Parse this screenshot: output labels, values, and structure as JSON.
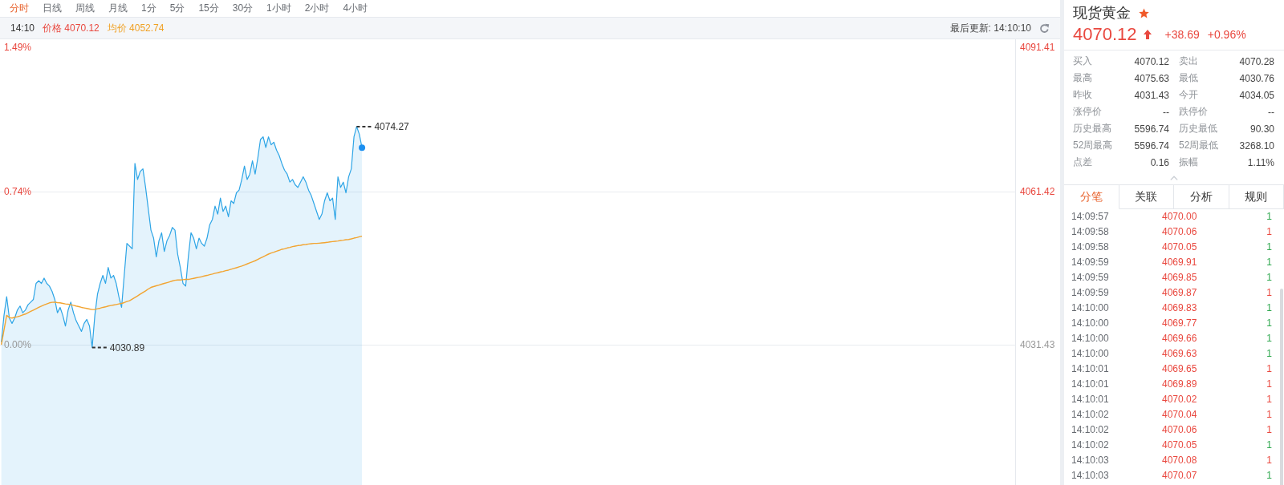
{
  "toolbar": {
    "tabs": [
      {
        "label": "分时",
        "selected": true
      },
      {
        "label": "日线",
        "selected": false
      },
      {
        "label": "周线",
        "selected": false
      },
      {
        "label": "月线",
        "selected": false
      },
      {
        "label": "1分",
        "selected": false
      },
      {
        "label": "5分",
        "selected": false
      },
      {
        "label": "15分",
        "selected": false
      },
      {
        "label": "30分",
        "selected": false
      },
      {
        "label": "1小时",
        "selected": false
      },
      {
        "label": "2小时",
        "selected": false
      },
      {
        "label": "4小时",
        "selected": false
      }
    ]
  },
  "info_bar": {
    "time": "14:10",
    "legend": [
      {
        "label": "价格",
        "value": "4070.12",
        "color": "#e9483f"
      },
      {
        "label": "均价",
        "value": "4052.74",
        "color": "#f0a023"
      }
    ],
    "last_updated": "最后更新: 14:10:10"
  },
  "chart": {
    "percent_labels": [
      {
        "text": "1.49%",
        "color": "#e9483f"
      },
      {
        "text": "0.74%",
        "color": "#e9483f"
      },
      {
        "text": "0.00%",
        "color": "#999999"
      }
    ],
    "chart_data": {
      "type": "area",
      "categories": [
        null,
        null,
        null,
        null,
        null,
        null,
        null,
        null,
        null,
        null,
        null,
        null,
        null,
        null,
        null,
        null,
        null,
        null,
        null,
        null,
        null,
        null,
        null,
        null,
        null,
        null,
        null,
        null,
        null,
        null,
        null,
        null,
        null,
        null,
        null,
        null,
        null,
        null,
        null,
        null,
        null,
        null,
        null,
        null,
        null,
        null,
        null,
        null,
        null,
        null,
        null,
        null,
        null,
        null,
        null,
        null,
        null,
        null,
        null,
        null,
        null,
        null,
        null,
        null,
        null,
        null,
        null,
        null,
        null,
        null,
        null,
        null,
        null,
        null,
        null,
        null,
        null,
        null,
        null,
        null,
        null,
        null,
        null,
        null,
        null,
        null,
        null,
        null,
        null,
        null,
        null,
        null,
        null,
        null,
        null,
        null,
        null,
        null,
        null,
        null,
        null,
        null,
        null,
        null,
        null,
        null,
        null,
        null,
        null,
        null,
        null,
        null,
        null,
        null,
        null,
        null,
        null,
        null,
        null,
        null,
        null,
        null,
        null,
        null,
        null,
        null,
        null,
        null,
        null,
        null,
        null,
        null,
        null,
        null,
        null,
        null,
        null,
        null,
        null,
        null,
        null,
        null,
        null,
        null,
        null,
        null,
        null,
        null,
        null,
        null,
        null,
        null,
        null,
        null,
        null,
        null,
        null,
        null,
        null,
        null,
        null,
        null,
        null,
        null,
        null,
        null,
        null,
        null,
        null,
        null,
        null,
        null,
        null,
        null,
        null,
        null,
        null,
        null,
        null,
        null,
        null,
        null,
        null,
        null,
        null,
        null,
        null,
        null,
        null,
        null,
        null,
        null,
        null,
        null,
        null,
        null,
        null,
        null,
        null,
        null,
        null,
        null,
        null,
        null,
        null,
        null,
        null,
        null,
        null,
        null,
        null,
        null,
        null,
        null,
        null,
        null,
        null,
        null,
        null,
        null,
        null,
        null,
        null,
        null,
        null,
        null,
        null,
        null,
        null,
        null,
        null,
        null,
        null,
        null,
        null,
        null,
        null,
        null,
        null,
        null,
        null,
        null,
        null,
        null,
        null,
        null,
        null,
        null,
        null,
        null,
        null,
        null,
        null,
        null,
        null,
        null,
        null,
        null,
        null,
        null,
        null,
        null,
        null,
        null,
        null,
        null,
        null,
        null,
        null,
        null,
        null,
        null,
        null,
        null,
        null,
        null,
        null,
        null,
        null,
        null,
        null,
        null,
        null,
        null,
        null,
        null,
        null,
        null,
        null,
        null,
        null,
        null,
        null,
        null,
        null,
        null,
        null,
        null,
        null,
        null,
        null,
        null,
        null,
        null,
        null,
        null,
        null,
        null,
        null,
        null,
        null,
        null,
        null,
        null,
        null,
        null,
        null,
        null,
        null,
        null,
        null,
        null,
        null,
        null,
        null,
        null,
        null,
        null,
        null,
        null,
        null,
        null,
        null,
        null,
        null,
        null,
        null,
        null,
        null,
        null,
        null,
        null,
        null,
        null,
        null,
        null,
        null,
        null,
        null,
        null,
        null,
        null,
        null,
        null,
        null,
        null,
        null,
        null,
        null,
        null,
        null,
        null,
        null,
        null,
        null,
        null,
        null,
        null,
        null,
        null,
        null,
        null,
        null,
        null,
        null,
        null,
        null,
        null,
        null,
        null
      ],
      "ylim": [
        4003.88,
        4091.41
      ],
      "yticks": [
        {
          "value": 4091.41,
          "label": "4091.41"
        },
        {
          "value": 4061.42,
          "label": "4061.42"
        },
        {
          "value": 4031.43,
          "label": "4031.43"
        }
      ],
      "series": [
        {
          "color": "#2ea5e6",
          "values": [
            4031.95,
            4037.19,
            4040.85,
            4036.66,
            4035.62,
            4036.66,
            4038.23,
            4039.02,
            4037.71,
            4038.23,
            4039.28,
            4039.8,
            4040.33,
            4043.47,
            4043.99,
            4043.47,
            4044.51,
            4043.47,
            4042.94,
            4041.9,
            4040.33,
            4037.71,
            4038.76,
            4037.19,
            4035.09,
            4038.23,
            4039.8,
            4037.71,
            4036.14,
            4035.09,
            4034.05,
            4035.62,
            4036.4,
            4035.09,
            4030.89,
            4037.19,
            4041.37,
            4043.47,
            4045.04,
            4043.47,
            4046.61,
            4044.51,
            4045.04,
            4043.47,
            4040.85,
            4038.76,
            4045.04,
            4051.32,
            4050.79,
            4050.27,
            4067.02,
            4063.88,
            4065.45,
            4065.97,
            4062.31,
            4058.12,
            4053.93,
            4052.36,
            4048.7,
            4051.84,
            4053.41,
            4049.75,
            4051.84,
            4052.89,
            4054.46,
            4053.93,
            4049.22,
            4046.61,
            4043.47,
            4042.94,
            4048.7,
            4053.41,
            4052.36,
            4050.27,
            4052.36,
            4051.32,
            4050.79,
            4052.36,
            4054.98,
            4056.03,
            4058.65,
            4057.08,
            4060.22,
            4057.6,
            4058.65,
            4056.55,
            4059.69,
            4059.17,
            4061.26,
            4061.79,
            4063.88,
            4066.5,
            4063.88,
            4064.93,
            4067.54,
            4064.93,
            4068.07,
            4071.73,
            4072.25,
            4070.16,
            4072.25,
            4070.68,
            4071.21,
            4069.64,
            4068.59,
            4067.02,
            4065.71,
            4064.93,
            4063.36,
            4063.88,
            4062.83,
            4062.31,
            4063.36,
            4064.4,
            4063.36,
            4061.79,
            4060.74,
            4059.17,
            4057.6,
            4056.03,
            4057.08,
            4059.69,
            4061.26,
            4059.69,
            4060.22,
            4056.03,
            4064.4,
            4062.31,
            4063.36,
            4061.26,
            4064.4,
            4065.97,
            4072.25,
            4074.27,
            4072.78,
            4070.12,
            null,
            null,
            null,
            null,
            null,
            null,
            null,
            null,
            null,
            null,
            null,
            null,
            null,
            null,
            null,
            null,
            null,
            null,
            null,
            null,
            null,
            null,
            null,
            null,
            null,
            null,
            null,
            null,
            null,
            null,
            null,
            null,
            null,
            null,
            null,
            null,
            null,
            null,
            null,
            null,
            null,
            null,
            null,
            null,
            null,
            null,
            null,
            null,
            null,
            null,
            null,
            null,
            null,
            null,
            null,
            null,
            null,
            null,
            null,
            null,
            null,
            null,
            null,
            null,
            null,
            null,
            null,
            null,
            null,
            null,
            null,
            null,
            null,
            null,
            null,
            null,
            null,
            null,
            null,
            null,
            null,
            null,
            null,
            null,
            null,
            null,
            null,
            null,
            null,
            null,
            null,
            null,
            null,
            null,
            null,
            null,
            null,
            null,
            null,
            null,
            null,
            null,
            null,
            null,
            null,
            null,
            null,
            null,
            null,
            null,
            null,
            null,
            null,
            null,
            null,
            null,
            null,
            null,
            null,
            null,
            null,
            null,
            null,
            null,
            null,
            null,
            null,
            null,
            null,
            null,
            null,
            null,
            null,
            null,
            null,
            null,
            null,
            null,
            null,
            null,
            null,
            null,
            null,
            null,
            null,
            null,
            null,
            null,
            null,
            null,
            null,
            null,
            null,
            null,
            null,
            null,
            null,
            null,
            null,
            null,
            null,
            null,
            null,
            null,
            null,
            null,
            null,
            null,
            null,
            null,
            null,
            null,
            null,
            null,
            null,
            null,
            null,
            null,
            null,
            null,
            null,
            null,
            null,
            null,
            null,
            null,
            null,
            null,
            null,
            null,
            null,
            null,
            null,
            null,
            null,
            null,
            null,
            null,
            null,
            null,
            null,
            null,
            null,
            null,
            null,
            null,
            null,
            null,
            null,
            null,
            null,
            null,
            null,
            null,
            null,
            null,
            null,
            null,
            null,
            null,
            null,
            null,
            null,
            null,
            null,
            null,
            null,
            null,
            null,
            null,
            null,
            null,
            null,
            null,
            null,
            null,
            null,
            null,
            null,
            null,
            null,
            null,
            null,
            null
          ]
        },
        {
          "type": "line",
          "color": "#f2a431",
          "values": [
            4031.43,
            4034.31,
            4037.19,
            4036.77,
            4036.66,
            4036.82,
            4036.92,
            4037.08,
            4037.29,
            4037.45,
            4037.71,
            4037.97,
            4038.23,
            4038.49,
            4038.76,
            4039.02,
            4039.23,
            4039.44,
            4039.65,
            4039.75,
            4039.8,
            4039.7,
            4039.65,
            4039.54,
            4039.44,
            4039.38,
            4039.28,
            4039.17,
            4039.02,
            4038.91,
            4038.76,
            4038.65,
            4038.55,
            4038.44,
            4038.34,
            4038.34,
            4038.49,
            4038.6,
            4038.76,
            4038.86,
            4039.02,
            4039.12,
            4039.23,
            4039.33,
            4039.44,
            4039.54,
            4039.7,
            4039.91,
            4040.06,
            4040.38,
            4040.69,
            4041.01,
            4041.37,
            4041.69,
            4042.0,
            4042.37,
            4042.68,
            4042.84,
            4043.0,
            4043.15,
            4043.31,
            4043.47,
            4043.62,
            4043.78,
            4043.94,
            4044.09,
            4044.15,
            4044.15,
            4044.2,
            4044.25,
            4044.25,
            4044.36,
            4044.46,
            4044.57,
            4044.67,
            4044.78,
            4044.93,
            4045.04,
            4045.19,
            4045.3,
            4045.46,
            4045.56,
            4045.72,
            4045.82,
            4045.98,
            4046.08,
            4046.24,
            4046.4,
            4046.55,
            4046.71,
            4046.87,
            4047.08,
            4047.29,
            4047.5,
            4047.71,
            4047.92,
            4048.18,
            4048.44,
            4048.7,
            4048.96,
            4049.22,
            4049.43,
            4049.59,
            4049.8,
            4049.96,
            4050.17,
            4050.27,
            4050.43,
            4050.53,
            4050.69,
            4050.79,
            4050.9,
            4050.95,
            4051.06,
            4051.11,
            4051.21,
            4051.27,
            4051.32,
            4051.32,
            4051.37,
            4051.42,
            4051.47,
            4051.53,
            4051.63,
            4051.68,
            4051.74,
            4051.79,
            4051.89,
            4051.95,
            4052.05,
            4052.1,
            4052.21,
            4052.36,
            4052.47,
            4052.63,
            4052.74,
            null,
            null,
            null,
            null,
            null,
            null,
            null,
            null,
            null,
            null,
            null,
            null,
            null,
            null,
            null,
            null,
            null,
            null,
            null,
            null,
            null,
            null,
            null,
            null,
            null,
            null,
            null,
            null,
            null,
            null,
            null,
            null,
            null,
            null,
            null,
            null,
            null,
            null,
            null,
            null,
            null,
            null,
            null,
            null,
            null,
            null,
            null,
            null,
            null,
            null,
            null,
            null,
            null,
            null,
            null,
            null,
            null,
            null,
            null,
            null,
            null,
            null,
            null,
            null,
            null,
            null,
            null,
            null,
            null,
            null,
            null,
            null,
            null,
            null,
            null,
            null,
            null,
            null,
            null,
            null,
            null,
            null,
            null,
            null,
            null,
            null,
            null,
            null,
            null,
            null,
            null,
            null,
            null,
            null,
            null,
            null,
            null,
            null,
            null,
            null,
            null,
            null,
            null,
            null,
            null,
            null,
            null,
            null,
            null,
            null,
            null,
            null,
            null,
            null,
            null,
            null,
            null,
            null,
            null,
            null,
            null,
            null,
            null,
            null,
            null,
            null,
            null,
            null,
            null,
            null,
            null,
            null,
            null,
            null,
            null,
            null,
            null,
            null,
            null,
            null,
            null,
            null,
            null,
            null,
            null,
            null,
            null,
            null,
            null,
            null,
            null,
            null,
            null,
            null,
            null,
            null,
            null,
            null,
            null,
            null,
            null,
            null,
            null,
            null,
            null,
            null,
            null,
            null,
            null,
            null,
            null,
            null,
            null,
            null,
            null,
            null,
            null,
            null,
            null,
            null,
            null,
            null,
            null,
            null,
            null,
            null,
            null,
            null,
            null,
            null,
            null,
            null,
            null,
            null,
            null,
            null,
            null,
            null,
            null,
            null,
            null,
            null,
            null,
            null,
            null,
            null,
            null,
            null,
            null,
            null,
            null,
            null,
            null,
            null,
            null,
            null,
            null,
            null,
            null,
            null,
            null,
            null,
            null,
            null,
            null,
            null,
            null,
            null,
            null,
            null,
            null,
            null,
            null,
            null,
            null,
            null,
            null,
            null,
            null,
            null,
            null,
            null,
            null,
            null
          ]
        }
      ],
      "annotations": [
        "4074.27",
        "4030.89"
      ]
    }
  },
  "quote": {
    "title": "现货黄金",
    "starred": true,
    "price": "4070.12",
    "rising": true,
    "change": "+38.69",
    "change_percent": "+0.96%",
    "stats": [
      {
        "label": "买入",
        "value": "4070.12"
      },
      {
        "label": "卖出",
        "value": "4070.28"
      },
      {
        "label": "最高",
        "value": "4075.63"
      },
      {
        "label": "最低",
        "value": "4030.76"
      },
      {
        "label": "昨收",
        "value": "4031.43"
      },
      {
        "label": "今开",
        "value": "4034.05"
      },
      {
        "label": "涨停价",
        "value": "--"
      },
      {
        "label": "跌停价",
        "value": "--"
      },
      {
        "label": "历史最高",
        "value": "5596.74"
      },
      {
        "label": "历史最低",
        "value": "90.30"
      },
      {
        "label": "52周最高",
        "value": "5596.74"
      },
      {
        "label": "52周最低",
        "value": "3268.10"
      },
      {
        "label": "点差",
        "value": "0.16"
      },
      {
        "label": "振幅",
        "value": "1.11%"
      }
    ]
  },
  "detail_tabs": [
    {
      "label": "分笔",
      "selected": true
    },
    {
      "label": "关联",
      "selected": false
    },
    {
      "label": "分析",
      "selected": false
    },
    {
      "label": "规则",
      "selected": false
    }
  ],
  "ticks": [
    {
      "time": "14:09:57",
      "price": "4070.00",
      "volume": "1",
      "color": "#2fa84f"
    },
    {
      "time": "14:09:58",
      "price": "4070.06",
      "volume": "1",
      "color": "#e9483f"
    },
    {
      "time": "14:09:58",
      "price": "4070.05",
      "volume": "1",
      "color": "#2fa84f"
    },
    {
      "time": "14:09:59",
      "price": "4069.91",
      "volume": "1",
      "color": "#2fa84f"
    },
    {
      "time": "14:09:59",
      "price": "4069.85",
      "volume": "1",
      "color": "#2fa84f"
    },
    {
      "time": "14:09:59",
      "price": "4069.87",
      "volume": "1",
      "color": "#e9483f"
    },
    {
      "time": "14:10:00",
      "price": "4069.83",
      "volume": "1",
      "color": "#2fa84f"
    },
    {
      "time": "14:10:00",
      "price": "4069.77",
      "volume": "1",
      "color": "#2fa84f"
    },
    {
      "time": "14:10:00",
      "price": "4069.66",
      "volume": "1",
      "color": "#2fa84f"
    },
    {
      "time": "14:10:00",
      "price": "4069.63",
      "volume": "1",
      "color": "#2fa84f"
    },
    {
      "time": "14:10:01",
      "price": "4069.65",
      "volume": "1",
      "color": "#e9483f"
    },
    {
      "time": "14:10:01",
      "price": "4069.89",
      "volume": "1",
      "color": "#e9483f"
    },
    {
      "time": "14:10:01",
      "price": "4070.02",
      "volume": "1",
      "color": "#e9483f"
    },
    {
      "time": "14:10:02",
      "price": "4070.04",
      "volume": "1",
      "color": "#e9483f"
    },
    {
      "time": "14:10:02",
      "price": "4070.06",
      "volume": "1",
      "color": "#e9483f"
    },
    {
      "time": "14:10:02",
      "price": "4070.05",
      "volume": "1",
      "color": "#2fa84f"
    },
    {
      "time": "14:10:03",
      "price": "4070.08",
      "volume": "1",
      "color": "#e9483f"
    },
    {
      "time": "14:10:03",
      "price": "4070.07",
      "volume": "1",
      "color": "#2fa84f"
    }
  ]
}
